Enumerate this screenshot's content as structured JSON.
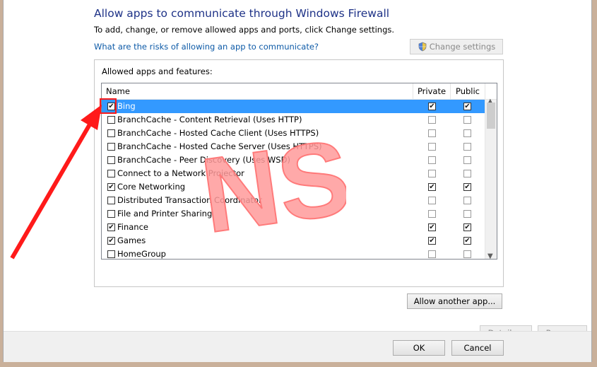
{
  "header": {
    "title": "Allow apps to communicate through Windows Firewall",
    "subtitle": "To add, change, or remove allowed apps and ports, click Change settings.",
    "risk_link": "What are the risks of allowing an app to communicate?",
    "change_settings_label": "Change settings"
  },
  "group": {
    "label": "Allowed apps and features:",
    "columns": {
      "name": "Name",
      "private": "Private",
      "public": "Public"
    },
    "rows": [
      {
        "name": "Bing",
        "enabled": true,
        "private": true,
        "public": true,
        "selected": true
      },
      {
        "name": "BranchCache - Content Retrieval (Uses HTTP)",
        "enabled": false,
        "private": false,
        "public": false
      },
      {
        "name": "BranchCache - Hosted Cache Client (Uses HTTPS)",
        "enabled": false,
        "private": false,
        "public": false
      },
      {
        "name": "BranchCache - Hosted Cache Server (Uses HTTPS)",
        "enabled": false,
        "private": false,
        "public": false
      },
      {
        "name": "BranchCache - Peer Discovery (Uses WSD)",
        "enabled": false,
        "private": false,
        "public": false
      },
      {
        "name": "Connect to a Network Projector",
        "enabled": false,
        "private": false,
        "public": false
      },
      {
        "name": "Core Networking",
        "enabled": true,
        "private": true,
        "public": true
      },
      {
        "name": "Distributed Transaction Coordinator",
        "enabled": false,
        "private": false,
        "public": false
      },
      {
        "name": "File and Printer Sharing",
        "enabled": false,
        "private": false,
        "public": false
      },
      {
        "name": "Finance",
        "enabled": true,
        "private": true,
        "public": true
      },
      {
        "name": "Games",
        "enabled": true,
        "private": true,
        "public": true
      },
      {
        "name": "HomeGroup",
        "enabled": false,
        "private": false,
        "public": false
      }
    ],
    "details_label": "Details...",
    "remove_label": "Remove"
  },
  "allow_another_label": "Allow another app...",
  "footer": {
    "ok_label": "OK",
    "cancel_label": "Cancel"
  },
  "watermark_text": "NS",
  "colors": {
    "heading": "#1e3287",
    "link": "#0d5aa7",
    "selection": "#3399ff",
    "annotation_red": "#ff1a1a",
    "watermark": "#ff9a9a"
  }
}
